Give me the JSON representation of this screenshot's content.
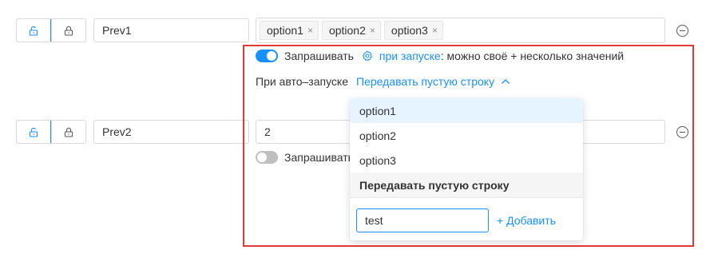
{
  "rows": [
    {
      "prev": "Prev1",
      "tags": [
        "option1",
        "option2",
        "option3"
      ],
      "tag_remove": "×"
    },
    {
      "prev": "Prev2",
      "value": "2",
      "ask_label": "Запрашивать"
    }
  ],
  "panel": {
    "ask_label": "Запрашивать",
    "launch_link": "при запуске",
    "launch_suffix": ": можно своё + несколько значений",
    "auto_label": "При авто–запуске",
    "auto_value": "Передавать пустую строку"
  },
  "dropdown": {
    "options": [
      "option1",
      "option2",
      "option3"
    ],
    "special": "Передавать пустую строку",
    "input_value": "test",
    "add_label": "+ Добавить"
  },
  "colors": {
    "accent": "#1890ff",
    "highlight_border": "#e53935"
  }
}
